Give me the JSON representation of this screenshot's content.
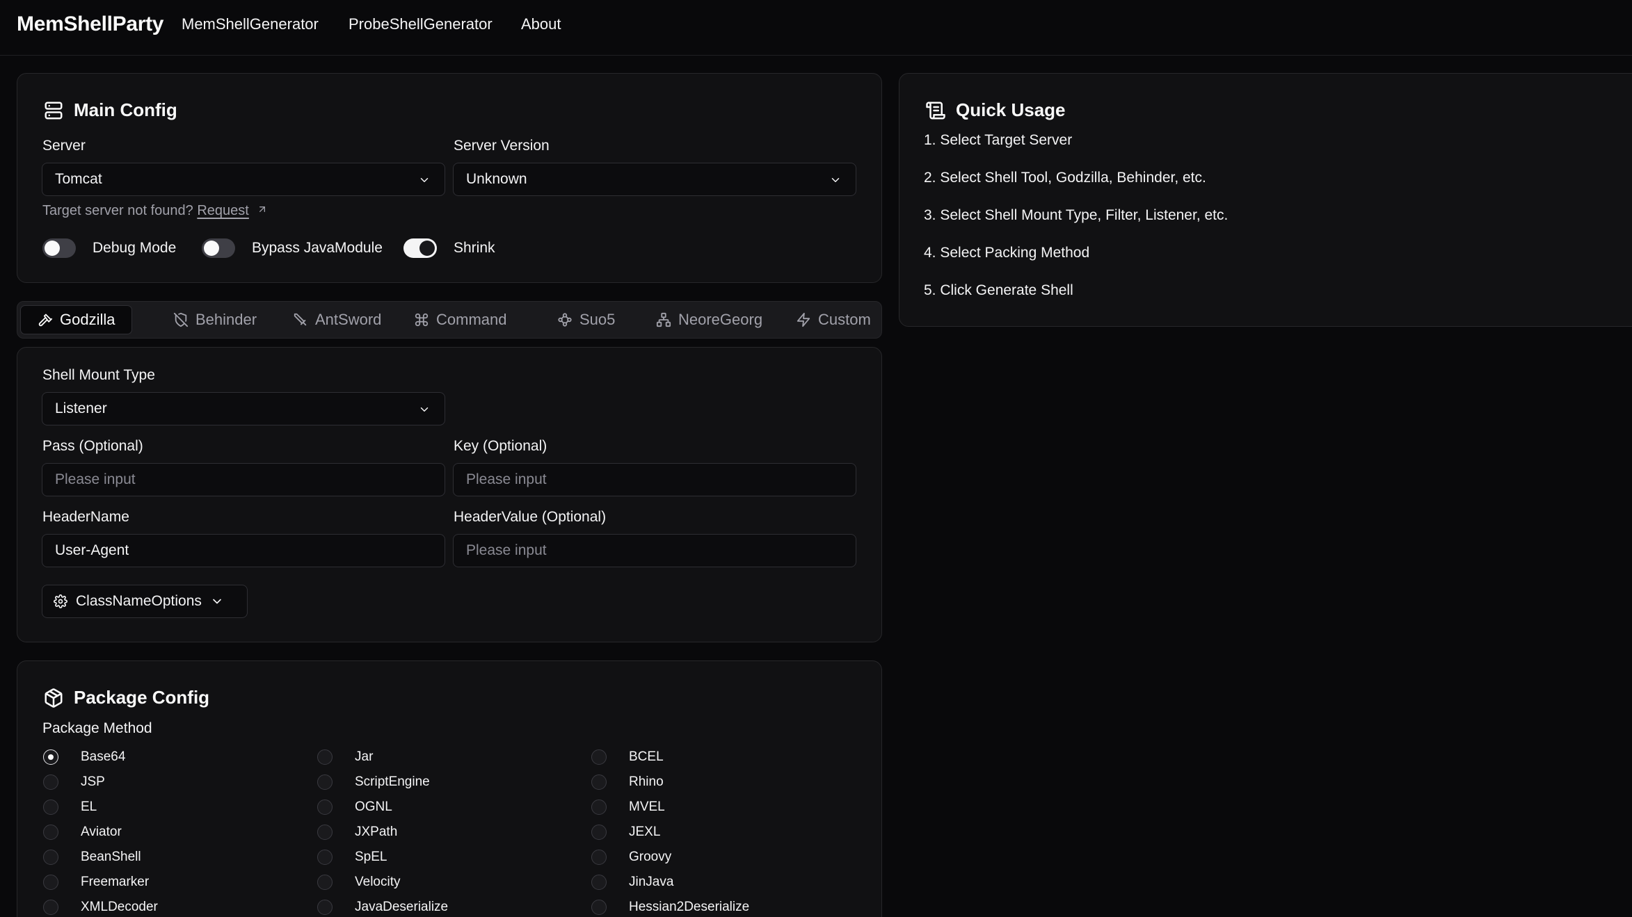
{
  "header": {
    "brand": "MemShellParty",
    "nav": [
      "MemShellGenerator",
      "ProbeShellGenerator",
      "About"
    ]
  },
  "main_config": {
    "title": "Main Config",
    "server_label": "Server",
    "server_value": "Tomcat",
    "server_version_label": "Server Version",
    "server_version_value": "Unknown",
    "not_found_text": "Target server not found?",
    "request_link": "Request",
    "toggles": [
      {
        "label": "Debug Mode",
        "on": false
      },
      {
        "label": "Bypass JavaModule",
        "on": false
      },
      {
        "label": "Shrink",
        "on": true
      }
    ]
  },
  "tabs": [
    {
      "label": "Godzilla",
      "icon": "hammer-icon",
      "active": true
    },
    {
      "label": "Behinder",
      "icon": "shield-off-icon"
    },
    {
      "label": "AntSword",
      "icon": "sword-icon"
    },
    {
      "label": "Command",
      "icon": "command-icon"
    },
    {
      "label": "Suo5",
      "icon": "workflow-icon"
    },
    {
      "label": "NeoreGeorg",
      "icon": "network-icon"
    },
    {
      "label": "Custom",
      "icon": "zap-icon"
    }
  ],
  "shell_config": {
    "mount_type_label": "Shell Mount Type",
    "mount_type_value": "Listener",
    "pass_label": "Pass (Optional)",
    "pass_placeholder": "Please input",
    "key_label": "Key (Optional)",
    "key_placeholder": "Please input",
    "header_name_label": "HeaderName",
    "header_name_value": "User-Agent",
    "header_value_label": "HeaderValue (Optional)",
    "header_value_placeholder": "Please input",
    "classname_options_label": "ClassNameOptions"
  },
  "package_config": {
    "title": "Package Config",
    "method_label": "Package Method",
    "selected": "Base64",
    "columns": [
      [
        "Base64",
        "JSP",
        "EL",
        "Aviator",
        "BeanShell",
        "Freemarker",
        "XMLDecoder"
      ],
      [
        "Jar",
        "ScriptEngine",
        "OGNL",
        "JXPath",
        "SpEL",
        "Velocity",
        "JavaDeserialize"
      ],
      [
        "BCEL",
        "Rhino",
        "MVEL",
        "JEXL",
        "Groovy",
        "JinJava",
        "Hessian2Deserialize"
      ]
    ]
  },
  "quick_usage": {
    "title": "Quick Usage",
    "steps": [
      "1. Select Target Server",
      "2. Select Shell Tool, Godzilla, Behinder, etc.",
      "3. Select Shell Mount Type, Filter, Listener, etc.",
      "4. Select Packing Method",
      "5. Click Generate Shell"
    ]
  }
}
